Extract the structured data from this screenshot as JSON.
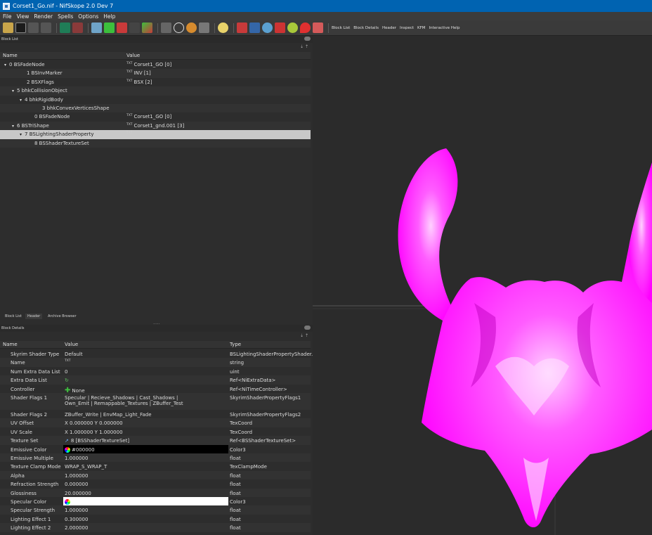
{
  "window": {
    "title": "Corset1_Go.nif - NifSkope 2.0 Dev 7"
  },
  "menu": [
    "File",
    "View",
    "Render",
    "Spells",
    "Options",
    "Help"
  ],
  "toolbar_tabs": [
    "Block List",
    "Block Details",
    "Header",
    "Inspect",
    "KFM",
    "Interactive Help"
  ],
  "block_list": {
    "title": "Block List",
    "col_name": "Name",
    "col_value": "Value",
    "rows": [
      {
        "name": "0 BSFadeNode",
        "value": "Corset1_GO [0]",
        "indent": 0,
        "arrow": "▾",
        "txt": true
      },
      {
        "name": "1 BSInvMarker",
        "value": "INV [1]",
        "indent": 2,
        "arrow": "",
        "txt": true
      },
      {
        "name": "2 BSXFlags",
        "value": "BSX [2]",
        "indent": 2,
        "arrow": "",
        "txt": true
      },
      {
        "name": "5 bhkCollisionObject",
        "value": "",
        "indent": 1,
        "arrow": "▾",
        "txt": false
      },
      {
        "name": "4 bhkRigidBody",
        "value": "",
        "indent": 2,
        "arrow": "▾",
        "txt": false
      },
      {
        "name": "3 bhkConvexVerticesShape",
        "value": "",
        "indent": 4,
        "arrow": "",
        "txt": false
      },
      {
        "name": "0 BSFadeNode",
        "value": "Corset1_GO [0]",
        "indent": 3,
        "arrow": "",
        "txt": true
      },
      {
        "name": "6 BSTriShape",
        "value": "Corset1_gnd.001 [3]",
        "indent": 1,
        "arrow": "▾",
        "txt": true
      },
      {
        "name": "7 BSLightingShaderProperty",
        "value": "",
        "indent": 2,
        "arrow": "▾",
        "txt": true
      },
      {
        "name": "8 BSShaderTextureSet",
        "value": "",
        "indent": 3,
        "arrow": "",
        "txt": false
      }
    ],
    "selected_index": 8
  },
  "dock_tabs": [
    "Block List",
    "Header",
    "Archive Browser"
  ],
  "block_details": {
    "title": "Block Details",
    "col_name": "Name",
    "col_value": "Value",
    "col_type": "Type",
    "rows": [
      {
        "name": "Skyrim Shader Type",
        "value": "Default",
        "type": "BSLightingShaderPropertyShader..."
      },
      {
        "name": "Name",
        "value": "",
        "type": "string",
        "txt": true
      },
      {
        "name": "Num Extra Data List",
        "value": "0",
        "type": "uint"
      },
      {
        "name": "Extra Data List",
        "value": "",
        "type": "Ref<NiExtraData>",
        "arrowicon": true
      },
      {
        "name": "Controller",
        "value": "None",
        "type": "Ref<NiTimeController>",
        "plus": true
      },
      {
        "name": "Shader Flags 1",
        "value": "Specular | Recieve_Shadows | Cast_Shadows |",
        "value2": "Own_Emit | Remappable_Textures | ZBuffer_Test",
        "type": "SkyrimShaderPropertyFlags1",
        "tall": true
      },
      {
        "name": "Shader Flags 2",
        "value": "ZBuffer_Write | EnvMap_Light_Fade",
        "type": "SkyrimShaderPropertyFlags2"
      },
      {
        "name": "UV Offset",
        "value": "X 0.000000 Y 0.000000",
        "type": "TexCoord"
      },
      {
        "name": "UV Scale",
        "value": "X 1.000000 Y 1.000000",
        "type": "TexCoord"
      },
      {
        "name": "Texture Set",
        "value": "8 [BSShaderTextureSet]",
        "type": "Ref<BSShaderTextureSet>",
        "link": true
      },
      {
        "name": "Emissive Color",
        "value": "#000000",
        "type": "Color3",
        "color": "#000000"
      },
      {
        "name": "Emissive Multiple",
        "value": "1.000000",
        "type": "float"
      },
      {
        "name": "Texture Clamp Mode",
        "value": "WRAP_S_WRAP_T",
        "type": "TexClampMode"
      },
      {
        "name": "Alpha",
        "value": "1.000000",
        "type": "float"
      },
      {
        "name": "Refraction Strength",
        "value": "0.000000",
        "type": "float"
      },
      {
        "name": "Glossiness",
        "value": "20.000000",
        "type": "float"
      },
      {
        "name": "Specular Color",
        "value": "",
        "type": "Color3",
        "color": "#ffffff"
      },
      {
        "name": "Specular Strength",
        "value": "1.000000",
        "type": "float"
      },
      {
        "name": "Lighting Effect 1",
        "value": "0.300000",
        "type": "float"
      },
      {
        "name": "Lighting Effect 2",
        "value": "2.000000",
        "type": "float"
      }
    ]
  },
  "colors": {
    "titlebar": "#0063b1",
    "mesh": "#ff00ff",
    "selection": "#c8c8c8"
  }
}
